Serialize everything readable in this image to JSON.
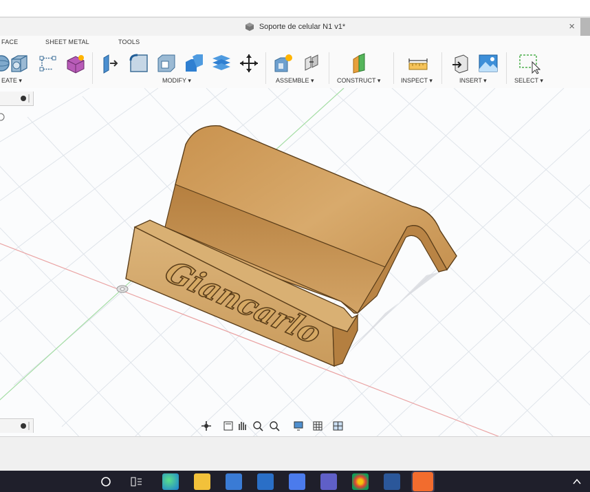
{
  "window": {
    "title": "Soporte de celular N1 v1*",
    "close_glyph": "×"
  },
  "tabs": [
    {
      "label": "FACE"
    },
    {
      "label": "SHEET METAL"
    },
    {
      "label": "TOOLS"
    }
  ],
  "ribbon": {
    "groups": [
      {
        "label": "EATE ▾"
      },
      {
        "label": "MODIFY ▾"
      },
      {
        "label": "ASSEMBLE ▾"
      },
      {
        "label": "CONSTRUCT ▾"
      },
      {
        "label": "INSPECT ▾"
      },
      {
        "label": "INSERT ▾"
      },
      {
        "label": "SELECT ▾"
      }
    ]
  },
  "model": {
    "engraved_text": "Giancarlo"
  },
  "icons": [
    "sphere-icon",
    "extrude-icon",
    "sketch-icon",
    "form-icon",
    "press-pull-icon",
    "fillet-icon",
    "shell-icon",
    "combine-icon",
    "layers-icon",
    "move-icon",
    "new-component-icon",
    "joint-icon",
    "construct-plane-icon",
    "measure-icon",
    "insert-mesh-icon",
    "insert-image-icon",
    "select-window-icon"
  ],
  "colors": {
    "wood": "#c99b5c",
    "wood_dark": "#9b7036",
    "wood_light": "#dcb47a",
    "grid": "#dde3ea",
    "x_axis": "#e8a0a0",
    "y_axis": "#9fdc9f",
    "taskbar": "#1f1f2b"
  }
}
